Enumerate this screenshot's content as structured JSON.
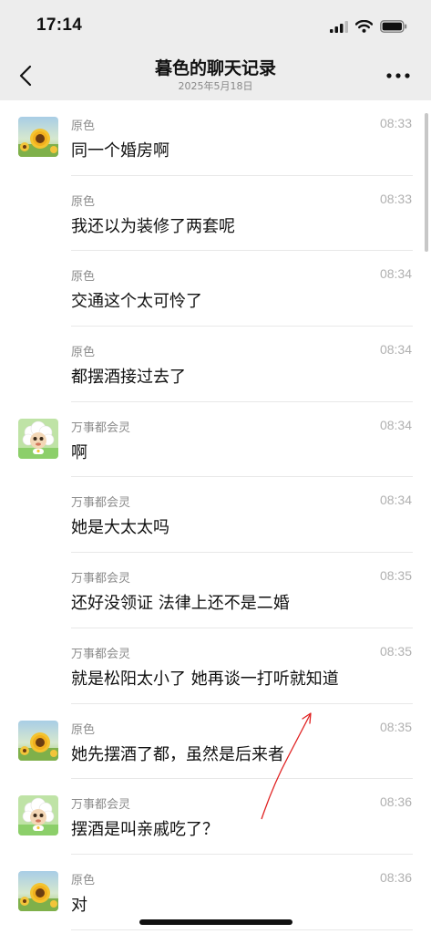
{
  "status_bar": {
    "time": "17:14"
  },
  "header": {
    "title": "暮色的聊天记录",
    "subtitle": "2025年5月18日"
  },
  "colors": {
    "background": "#ffffff",
    "nav": "#ededed",
    "annotation": "#e02020"
  },
  "messages": [
    {
      "sender": "原色",
      "time": "08:33",
      "text": "同一个婚房啊",
      "avatar": "sunflower"
    },
    {
      "sender": "原色",
      "time": "08:33",
      "text": "我还以为装修了两套呢",
      "avatar": ""
    },
    {
      "sender": "原色",
      "time": "08:34",
      "text": "交通这个太可怜了",
      "avatar": ""
    },
    {
      "sender": "原色",
      "time": "08:34",
      "text": "都摆酒接过去了",
      "avatar": ""
    },
    {
      "sender": "万事都会灵",
      "time": "08:34",
      "text": "啊",
      "avatar": "sheep"
    },
    {
      "sender": "万事都会灵",
      "time": "08:34",
      "text": "她是大太太吗",
      "avatar": ""
    },
    {
      "sender": "万事都会灵",
      "time": "08:35",
      "text": "还好没领证 法律上还不是二婚",
      "avatar": ""
    },
    {
      "sender": "万事都会灵",
      "time": "08:35",
      "text": "就是松阳太小了 她再谈一打听就知道",
      "avatar": ""
    },
    {
      "sender": "原色",
      "time": "08:35",
      "text": "她先摆酒了都，虽然是后来者",
      "avatar": "sunflower"
    },
    {
      "sender": "万事都会灵",
      "time": "08:36",
      "text": "摆酒是叫亲戚吃了？",
      "avatar": "sheep"
    },
    {
      "sender": "原色",
      "time": "08:36",
      "text": "对",
      "avatar": "sunflower"
    }
  ]
}
